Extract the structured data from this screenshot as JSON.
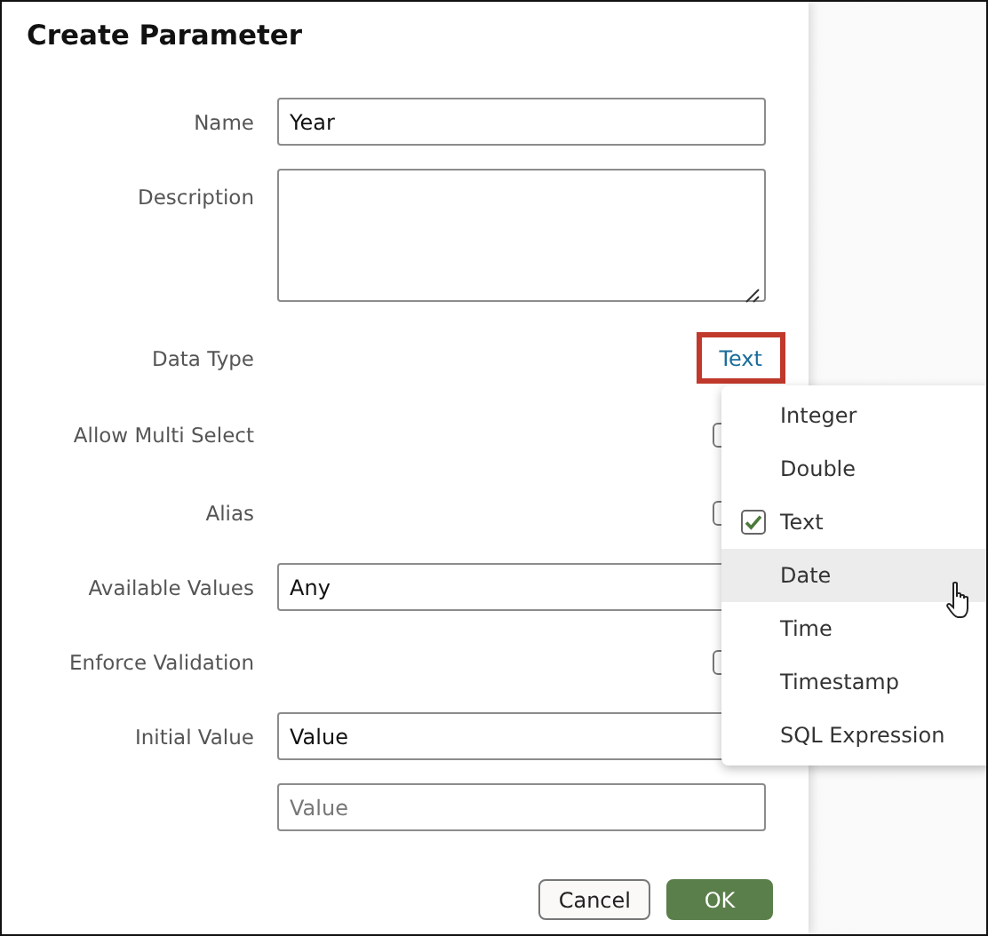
{
  "dialog": {
    "title": "Create Parameter",
    "fields": [
      {
        "kind": "text",
        "label": "Name",
        "value": "Year"
      },
      {
        "kind": "textarea",
        "label": "Description"
      },
      {
        "kind": "link",
        "label": "Data Type",
        "value": "Text",
        "highlighted": true
      },
      {
        "kind": "checkbox",
        "label": "Allow Multi Select",
        "checked": false
      },
      {
        "kind": "checkbox",
        "label": "Alias",
        "checked": false
      },
      {
        "kind": "select",
        "label": "Available Values",
        "value": "Any"
      },
      {
        "kind": "checkbox",
        "label": "Enforce Validation",
        "checked": false
      },
      {
        "kind": "text",
        "label": "Initial Value",
        "value": "Value"
      },
      {
        "kind": "text",
        "placeholder": "Value"
      }
    ],
    "buttons": [
      {
        "kind": "secondary",
        "label": "Cancel"
      },
      {
        "kind": "primary",
        "label": "OK"
      }
    ]
  },
  "menu": {
    "items": [
      {
        "label": "Integer",
        "selected": false,
        "hovered": false
      },
      {
        "label": "Double",
        "selected": false,
        "hovered": false
      },
      {
        "label": "Text",
        "selected": true,
        "hovered": false
      },
      {
        "label": "Date",
        "selected": false,
        "hovered": true
      },
      {
        "label": "Time",
        "selected": false,
        "hovered": false
      },
      {
        "label": "Timestamp",
        "selected": false,
        "hovered": false
      },
      {
        "label": "SQL Expression",
        "selected": false,
        "hovered": false
      }
    ]
  }
}
